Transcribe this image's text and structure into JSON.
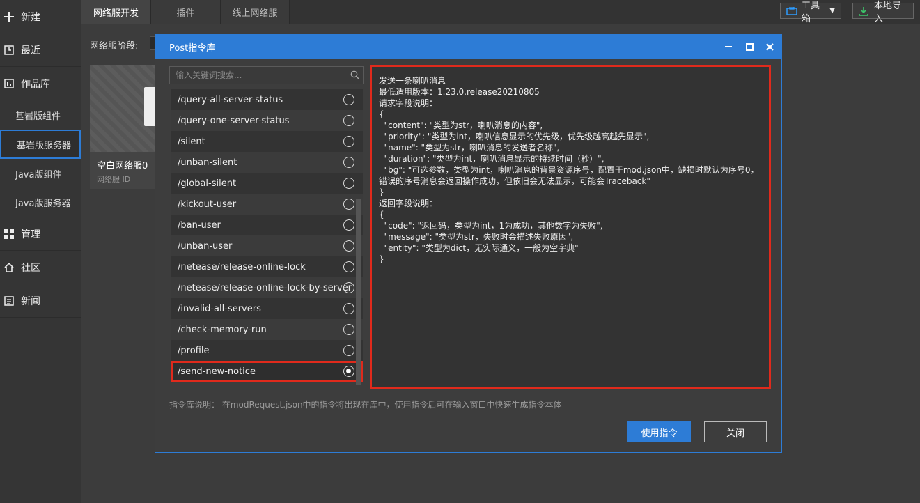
{
  "sidebar": {
    "items": [
      {
        "label": "新建",
        "icon": "plus-icon"
      },
      {
        "label": "最近",
        "icon": "clock-icon"
      },
      {
        "label": "作品库",
        "icon": "library-icon"
      }
    ],
    "sub_items": [
      {
        "label": "基岩版组件"
      },
      {
        "label": "基岩版服务器"
      },
      {
        "label": "Java版组件"
      },
      {
        "label": "Java版服务器"
      }
    ],
    "items_bottom": [
      {
        "label": "管理",
        "icon": "grid-icon"
      },
      {
        "label": "社区",
        "icon": "home-icon"
      },
      {
        "label": "新闻",
        "icon": "news-icon"
      }
    ]
  },
  "tabs": [
    {
      "label": "网络服开发"
    },
    {
      "label": "插件"
    },
    {
      "label": "线上网络服"
    }
  ],
  "toolbar": {
    "toolbox_label": "工具箱",
    "import_label": "本地导入"
  },
  "background": {
    "stage_label": "网络服阶段:",
    "card_title": "空白网络服0",
    "card_sub": "网络服 ID"
  },
  "dialog": {
    "title": "Post指令库",
    "search_placeholder": "输入关键词搜索...",
    "commands": [
      "/query-all-server-status",
      "/query-one-server-status",
      "/silent",
      "/unban-silent",
      "/global-silent",
      "/kickout-user",
      "/ban-user",
      "/unban-user",
      "/netease/release-online-lock",
      "/netease/release-online-lock-by-server",
      "/invalid-all-servers",
      "/check-memory-run",
      "/profile",
      "/send-new-notice"
    ],
    "selected_command": "/send-new-notice",
    "detail_lines": [
      "发送一条喇叭消息",
      "",
      "最低适用版本：1.23.0.release20210805",
      "",
      "请求字段说明：",
      "{",
      "  \"content\": \"类型为str，喇叭消息的内容\",",
      "  \"priority\": \"类型为int，喇叭信息显示的优先级，优先级越高越先显示\",",
      "  \"name\": \"类型为str，喇叭消息的发送者名称\",",
      "  \"duration\": \"类型为int，喇叭消息显示的持续时间（秒）\",",
      "  \"bg\": \"可选参数，类型为int，喇叭消息的背景资源序号，配置于mod.json中，缺损时默认为序号0，",
      "错误的序号消息会返回操作成功，但依旧会无法显示，可能会Traceback\"",
      "}",
      "",
      "返回字段说明：",
      "{",
      "  \"code\": \"返回码，类型为int，1为成功，其他数字为失败\",",
      "  \"message\": \"类型为str，失败时会描述失败原因\",",
      "  \"entity\": \"类型为dict，无实际通义，一般为空字典\"",
      "}"
    ],
    "hint": "指令库说明： 在modRequest.json中的指令将出现在库中，使用指令后可在输入窗口中快速生成指令本体",
    "use_label": "使用指令",
    "close_label": "关闭"
  }
}
